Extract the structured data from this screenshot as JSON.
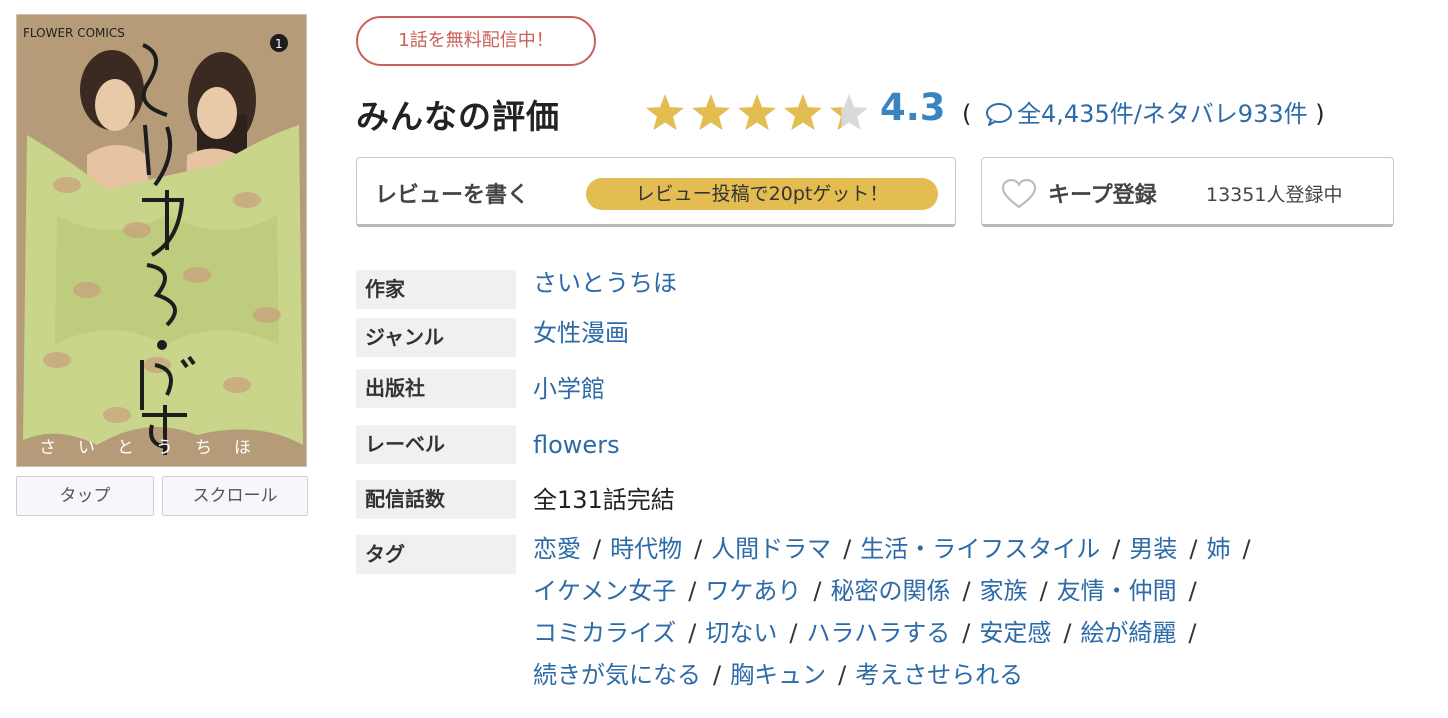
{
  "cover": {
    "series_text": "FLOWER COMICS",
    "title_art": "とりかえ・ばや",
    "author_art": "さいとうちほ",
    "volume": "1"
  },
  "viewer_buttons": {
    "tap": "タップ",
    "scroll": "スクロール"
  },
  "badge": "1話を無料配信中！",
  "rating": {
    "heading": "みんなの評価",
    "value": "4.3",
    "score": 4.3,
    "max": 5,
    "open_paren": "(",
    "reviews_link": "全4,435件/ネタバレ933件",
    "close_paren": ")",
    "star_color": "#e3bd51"
  },
  "write_review": {
    "label": "レビューを書く",
    "promo": "レビュー投稿で20ptゲット！"
  },
  "keep": {
    "label": "キープ登録",
    "count": "13351人登録中"
  },
  "details": [
    {
      "label": "作家",
      "value": "さいとうちほ"
    },
    {
      "label": "ジャンル",
      "value": "女性漫画"
    },
    {
      "label": "出版社",
      "value": "小学館"
    },
    {
      "label": "レーベル",
      "value": "flowers"
    },
    {
      "label": "配信話数",
      "value": "全131話完結"
    },
    {
      "label": "タグ"
    }
  ],
  "tags": [
    [
      "恋愛",
      "時代物",
      "人間ドラマ",
      "生活・ライフスタイル",
      "男装",
      "姉"
    ],
    [
      "イケメン女子",
      "ワケあり",
      "秘密の関係",
      "家族",
      "友情・仲間"
    ],
    [
      "コミカライズ",
      "切ない",
      "ハラハラする",
      "安定感",
      "絵が綺麗"
    ],
    [
      "続きが気になる",
      "胸キュン",
      "考えさせられる"
    ]
  ],
  "tag_separator": "/",
  "colors": {
    "link": "#2c6ba8",
    "rating": "#3a84bf",
    "badge": "#c9605a",
    "promo": "#e3bd51"
  }
}
